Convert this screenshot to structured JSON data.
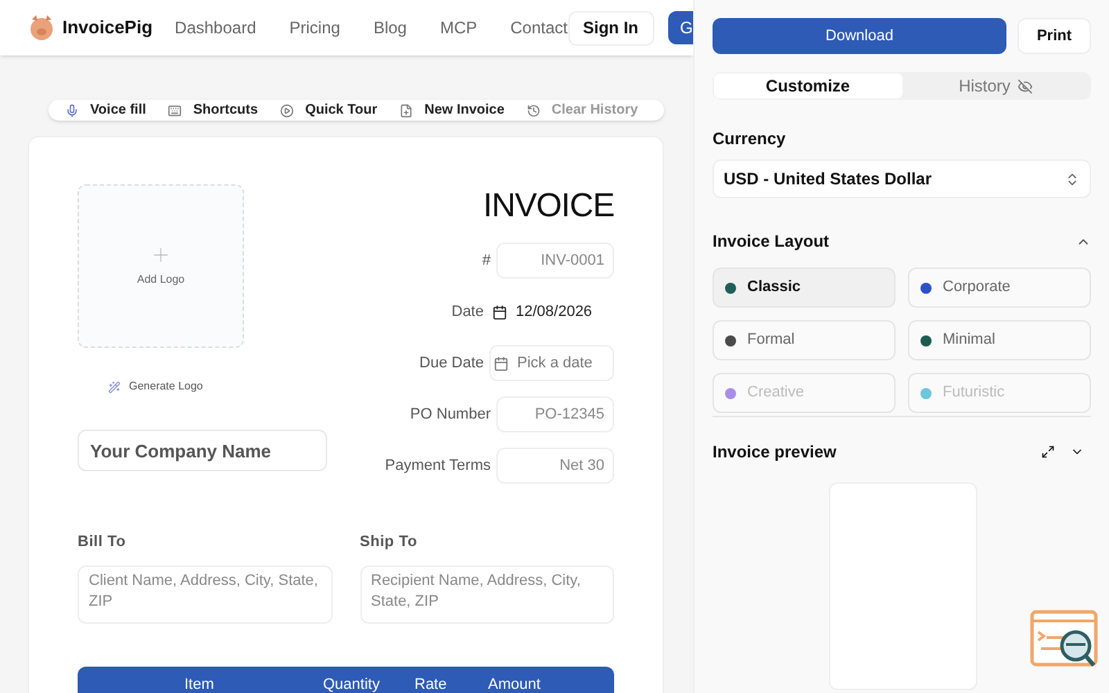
{
  "header": {
    "brand": "InvoicePig",
    "nav": [
      "Dashboard",
      "Pricing",
      "Blog",
      "MCP",
      "Contact"
    ],
    "sign_in": "Sign In",
    "cta": "G"
  },
  "toolbar": [
    {
      "kind": "mic",
      "label": "Voice fill",
      "disabled": false
    },
    {
      "kind": "keyboard",
      "label": "Shortcuts",
      "disabled": false
    },
    {
      "kind": "play",
      "label": "Quick Tour",
      "disabled": false
    },
    {
      "kind": "file",
      "label": "New Invoice",
      "disabled": false
    },
    {
      "kind": "history",
      "label": "Clear History",
      "disabled": true
    }
  ],
  "invoice": {
    "title": "INVOICE",
    "add_logo": "Add Logo",
    "generate_logo": "Generate Logo",
    "company_placeholder": "Your Company Name",
    "fields": [
      {
        "label": "#",
        "kind": "text",
        "placeholder": "INV-0001"
      },
      {
        "label": "Date",
        "kind": "date",
        "value": "12/08/2026"
      },
      {
        "label": "Due Date",
        "kind": "date",
        "placeholder": "Pick a date"
      },
      {
        "label": "PO Number",
        "kind": "text",
        "placeholder": "PO-12345"
      },
      {
        "label": "Payment Terms",
        "kind": "text",
        "placeholder": "Net 30"
      }
    ],
    "bill_to": {
      "label": "Bill To",
      "placeholder": "Client Name, Address, City, State, ZIP"
    },
    "ship_to": {
      "label": "Ship To",
      "placeholder": "Recipient Name, Address, City, State, ZIP"
    },
    "table": {
      "columns": [
        "Item",
        "Quantity",
        "Rate",
        "Amount"
      ]
    }
  },
  "panel": {
    "download": "Download",
    "print": "Print",
    "tabs": [
      {
        "label": "Customize",
        "selected": true
      },
      {
        "label": "History",
        "selected": false
      }
    ],
    "currency": {
      "label": "Currency",
      "value": "USD - United States Dollar"
    },
    "layout": {
      "title": "Invoice Layout",
      "expanded": true,
      "options": [
        {
          "label": "Classic",
          "color": "#1f5f5b",
          "selected": true,
          "disabled": false
        },
        {
          "label": "Corporate",
          "color": "#2d50c8",
          "selected": false,
          "disabled": false
        },
        {
          "label": "Formal",
          "color": "#4a4a4a",
          "selected": false,
          "disabled": false
        },
        {
          "label": "Minimal",
          "color": "#1a5c52",
          "selected": false,
          "disabled": false
        },
        {
          "label": "Creative",
          "color": "#a98ee8",
          "selected": false,
          "disabled": true
        },
        {
          "label": "Futuristic",
          "color": "#6cc6dc",
          "selected": false,
          "disabled": true
        }
      ]
    },
    "preview": {
      "title": "Invoice preview",
      "expanded": true
    }
  }
}
